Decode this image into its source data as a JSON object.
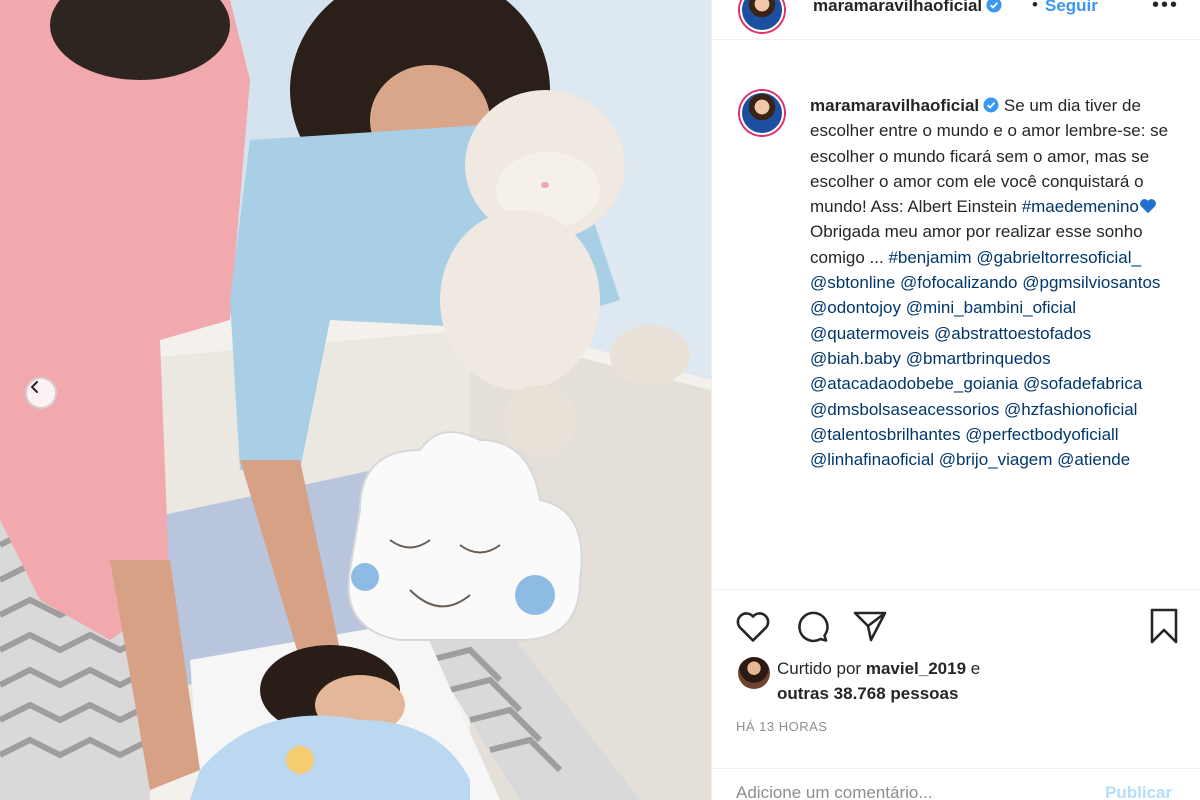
{
  "post": {
    "username": "maramaravilhaoficial",
    "follow_separator": "•",
    "follow_label": "Seguir",
    "more_label": "•••"
  },
  "caption": {
    "username": "maramaravilhaoficial",
    "text1": "Se um dia tiver de escolher entre o mundo e o amor lembre-se: se escolher o mundo ficará sem o amor, mas se escolher o amor com ele você conquistará o mundo! Ass: Albert Einstein",
    "tag_maedemenino": "#maedemenino",
    "text2": "Obrigada meu amor por realizar esse sonho comigo ...",
    "tags": [
      "#benjamim",
      "@gabrieltorresoficial_",
      "@sbtonline",
      "@fofocalizando",
      "@pgmsilviosantos",
      "@odontojoy",
      "@mini_bambini_oficial",
      "@quatermoveis",
      "@abstrattoestofados",
      "@biah.baby",
      "@bmartbrinquedos",
      "@atacadaodobebe_goiania",
      "@sofadefabrica",
      "@dmsbolsaseacessorios",
      "@hzfashionoficial",
      "@talentosbrilhantes",
      "@perfectbodyoficiall",
      "@linhafinaoficial",
      "@brijo_viagem",
      "@atiende"
    ]
  },
  "likes": {
    "prefix": "Curtido por",
    "liker": "maviel_2019",
    "conj": "e",
    "others": "outras 38.768 pessoas"
  },
  "timestamp": "HÁ 13 HORAS",
  "comment": {
    "placeholder": "Adicione um comentário...",
    "publish_label": "Publicar"
  },
  "colors": {
    "link": "#00376b",
    "follow": "#3897f0",
    "verified": "#3897f0",
    "publish_disabled": "#b2dffc",
    "muted": "#8e8e8e"
  },
  "icons": {
    "like": "heart-icon",
    "comment": "comment-icon",
    "share": "share-icon",
    "save": "bookmark-icon",
    "verified": "verified-badge-icon",
    "carousel_prev": "chevron-left-icon"
  }
}
